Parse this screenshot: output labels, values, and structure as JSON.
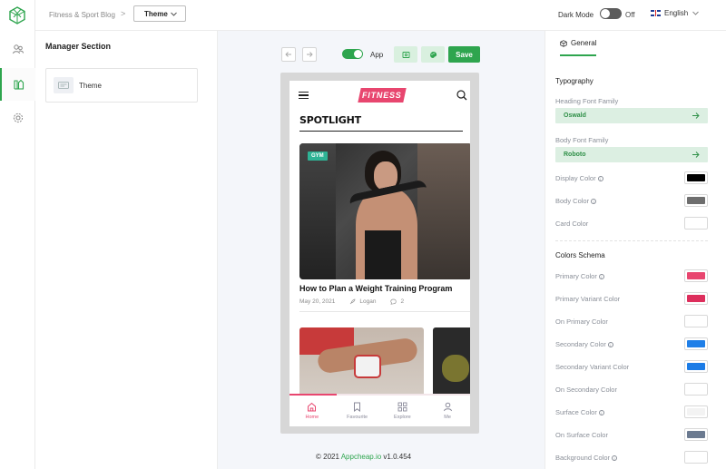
{
  "topbar": {
    "breadcrumb": "Fitness & Sport Blog",
    "breadcrumb_sep": ">",
    "theme_dropdown": "Theme",
    "dark_mode_label": "Dark Mode",
    "dark_mode_state": "Off",
    "language": "English"
  },
  "rail": {
    "icons": [
      "logo-icon",
      "users-icon",
      "theme-icon",
      "settings-icon"
    ],
    "active": "theme-icon"
  },
  "manager": {
    "title": "Manager Section",
    "items": [
      {
        "label": "Theme",
        "icon": "theme-card-icon"
      }
    ]
  },
  "canvas": {
    "app_label": "App",
    "save_label": "Save",
    "footer_copyright": "© 2021",
    "footer_link": "Appcheap.io",
    "footer_version": "v1.0.454"
  },
  "phone": {
    "brand": "FITNESS",
    "section_title": "SPOTLIGHT",
    "article": {
      "tag": "GYM",
      "title": "How to Plan a Weight Training Program",
      "date": "May 20, 2021",
      "author": "Logan",
      "comments": "2"
    },
    "progress": 0.26,
    "tabs": [
      {
        "label": "Home",
        "icon": "home-icon",
        "active": true
      },
      {
        "label": "Favourite",
        "icon": "bookmark-icon",
        "active": false
      },
      {
        "label": "Explore",
        "icon": "grid-icon",
        "active": false
      },
      {
        "label": "Me",
        "icon": "user-icon",
        "active": false
      }
    ]
  },
  "settings": {
    "tab_label": "General",
    "typography_title": "Typography",
    "heading_font_label": "Heading Font Family",
    "heading_font_value": "Oswald",
    "body_font_label": "Body Font Family",
    "body_font_value": "Roboto",
    "typography_colors": [
      {
        "label": "Display Color",
        "info": true,
        "color": "#000000"
      },
      {
        "label": "Body Color",
        "info": true,
        "color": "#6e6e6e"
      },
      {
        "label": "Card Color",
        "info": false,
        "color": "#ffffff"
      }
    ],
    "schema_title": "Colors Schema",
    "schema_colors": [
      {
        "label": "Primary Color",
        "info": true,
        "color": "#e8466f"
      },
      {
        "label": "Primary Variant Color",
        "info": false,
        "color": "#dd2e5c"
      },
      {
        "label": "On Primary Color",
        "info": false,
        "color": "#ffffff"
      },
      {
        "label": "Secondary Color",
        "info": true,
        "color": "#1f7fe8"
      },
      {
        "label": "Secondary Variant Color",
        "info": false,
        "color": "#1c7ce6"
      },
      {
        "label": "On Secondary Color",
        "info": false,
        "color": "#ffffff"
      },
      {
        "label": "Surface Color",
        "info": true,
        "color": "#f3f3f3"
      },
      {
        "label": "On Surface Color",
        "info": false,
        "color": "#6b7a90"
      },
      {
        "label": "Background Color",
        "info": true,
        "color": "#ffffff"
      }
    ]
  },
  "colors": {
    "accent": "#2ea54e",
    "brand": "#e8466f"
  }
}
